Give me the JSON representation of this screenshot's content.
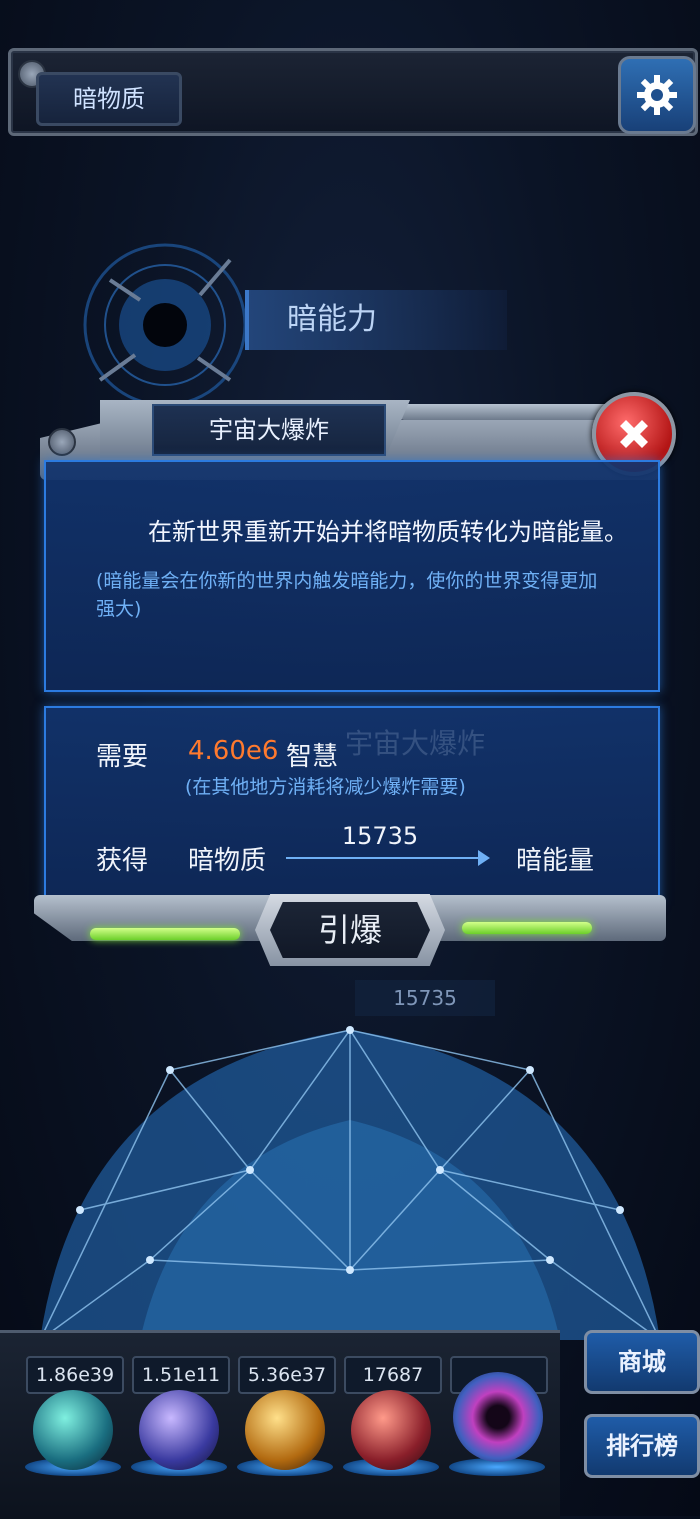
{
  "header": {
    "title": "暗物质"
  },
  "background": {
    "ability_label": "暗能力",
    "ghost_title": "宇宙大爆炸",
    "ghost_value": "15735"
  },
  "dialog": {
    "title": "宇宙大爆炸",
    "description": "在新世界重新开始并将暗物质转化为暗能量。",
    "note": "(暗能量会在你新的世界内触发暗能力，使你的世界变得更加强大)",
    "require_label": "需要",
    "require_value": "4.60e6",
    "require_unit": "智慧",
    "require_note": "(在其他地方消耗将减少爆炸需要)",
    "gain_label": "获得",
    "gain_from": "暗物质",
    "gain_amount": "15735",
    "gain_to": "暗能量",
    "detonate_label": "引爆"
  },
  "resources": [
    {
      "value": "1.86e39",
      "icon": "green-crystal-orb-icon",
      "color": "#2fb7a6"
    },
    {
      "value": "1.51e11",
      "icon": "lightning-orb-icon",
      "color": "#5a6ad8"
    },
    {
      "value": "5.36e37",
      "icon": "fire-orb-icon",
      "color": "#e0a020"
    },
    {
      "value": "17687",
      "icon": "brain-orb-icon",
      "color": "#c03a3a"
    },
    {
      "value": "",
      "icon": "black-hole-orb-icon",
      "color": "#c040c0"
    }
  ],
  "side_buttons": {
    "shop": "商城",
    "leaderboard": "排行榜"
  }
}
